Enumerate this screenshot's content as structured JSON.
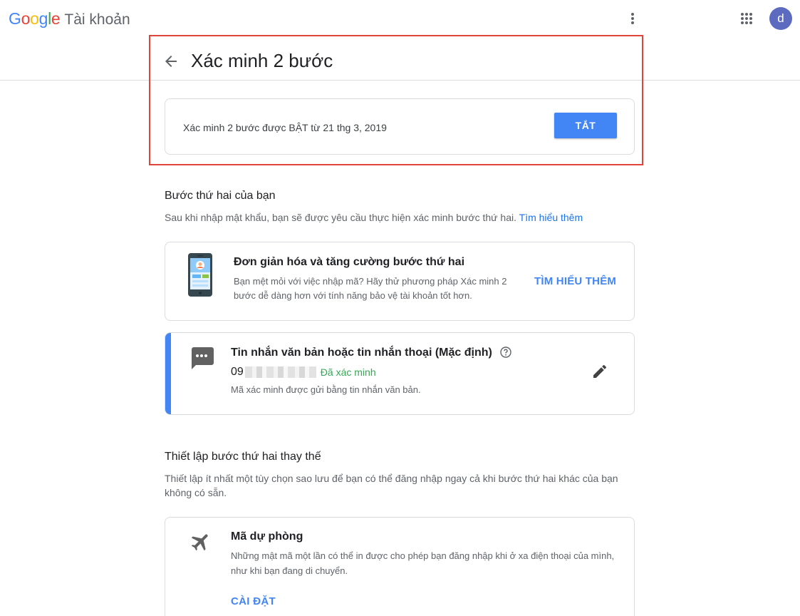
{
  "header": {
    "logo_brand": "Google",
    "logo_product": "Tài khoản",
    "avatar_initial": "d"
  },
  "page": {
    "title": "Xác minh 2 bước"
  },
  "status": {
    "text": "Xác minh 2 bước được BẬT từ 21 thg 3, 2019",
    "button_label": "TẮT"
  },
  "second_step": {
    "title": "Bước thứ hai của bạn",
    "description": "Sau khi nhập mật khẩu, bạn sẽ được yêu cầu thực hiện xác minh bước thứ hai.",
    "learn_more_link": "Tìm hiểu thêm"
  },
  "promo": {
    "title": "Đơn giản hóa và tăng cường bước thứ hai",
    "description": "Bạn mệt mỏi với việc nhập mã? Hãy thử phương pháp Xác minh 2 bước dễ dàng hơn với tính năng bảo vệ tài khoản tốt hơn.",
    "link_label": "TÌM HIỂU THÊM"
  },
  "sms": {
    "title": "Tin nhắn văn bản hoặc tin nhắn thoại (Mặc định)",
    "phone_prefix": "09",
    "verified_label": "Đã xác minh",
    "description": "Mã xác minh được gửi bằng tin nhắn văn bản."
  },
  "alternate": {
    "title": "Thiết lập bước thứ hai thay thế",
    "description": "Thiết lập ít nhất một tùy chọn sao lưu để bạn có thể đăng nhập ngay cả khi bước thứ hai khác của bạn không có sẵn."
  },
  "backup": {
    "title": "Mã dự phòng",
    "description": "Những mật mã một lần có thể in được cho phép bạn đăng nhập khi ở xa điện thoại của mình, như khi bạn đang di chuyển.",
    "setup_label": "CÀI ĐẶT"
  },
  "colors": {
    "accent": "#4285f4",
    "highlight_border": "#e0443b",
    "verified": "#34a853"
  },
  "icons": [
    "more-vert-icon",
    "apps-grid-icon",
    "back-arrow-icon",
    "phone-illustration",
    "sms-icon",
    "help-icon",
    "edit-pencil-icon",
    "airplane-icon"
  ]
}
